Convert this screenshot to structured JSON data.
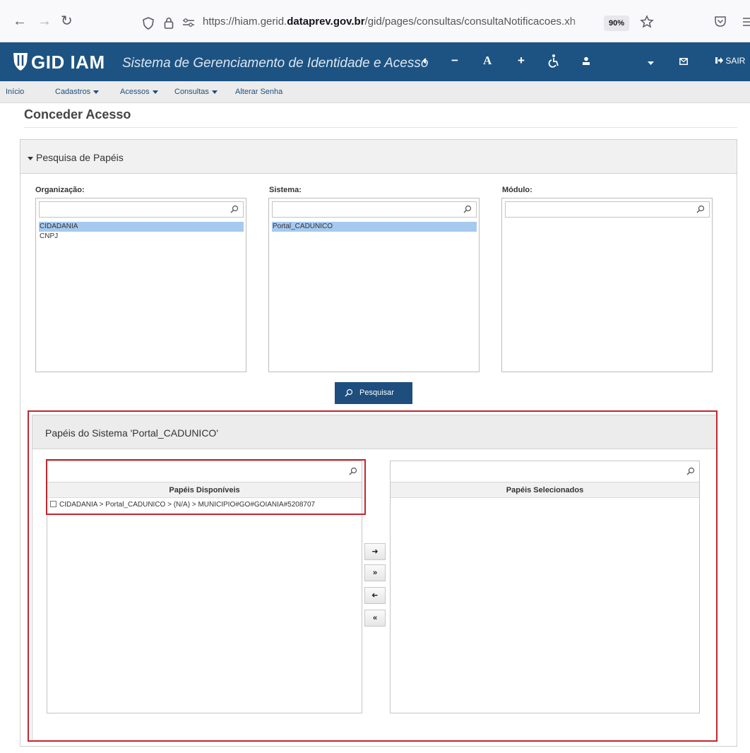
{
  "browser": {
    "url_prefix": "https://hiam.gerid.",
    "url_domain": "dataprev.gov.br",
    "url_path": "/gid/pages/consultas/consultaNotificacoes.xh",
    "zoom": "90%"
  },
  "app": {
    "logo": "GID IAM",
    "subtitle": "Sistema de Gerenciamento de Identidade e Acesso",
    "logout_label": "SAIR",
    "colors": {
      "header": "#1d5382",
      "button": "#1d4e7e",
      "selection": "#a6c9ee",
      "highlight": "#c1272d"
    }
  },
  "menu": {
    "inicio": "Início",
    "cadastros": "Cadastros",
    "acessos": "Acessos",
    "consultas": "Consultas",
    "alterar_senha": "Alterar Senha"
  },
  "page": {
    "title": "Conceder Acesso"
  },
  "search_panel": {
    "title": "Pesquisa de Papéis",
    "organizacao": {
      "label": "Organização:",
      "options": [
        "CIDADANIA",
        "CNPJ"
      ],
      "selected": "CIDADANIA"
    },
    "sistema": {
      "label": "Sistema:",
      "options": [
        "Portal_CADUNICO"
      ],
      "selected": "Portal_CADUNICO"
    },
    "modulo": {
      "label": "Módulo:",
      "options": []
    },
    "search_button": "Pesquisar"
  },
  "roles_panel": {
    "title": "Papéis do Sistema 'Portal_CADUNICO'",
    "available_header": "Papéis Disponíveis",
    "selected_header": "Papéis Selecionados",
    "available_items": [
      "CIDADANIA > Portal_CADUNICO > (N/A) > MUNICIPIO#GO#GOIANIA#5208707"
    ],
    "selected_items": []
  }
}
